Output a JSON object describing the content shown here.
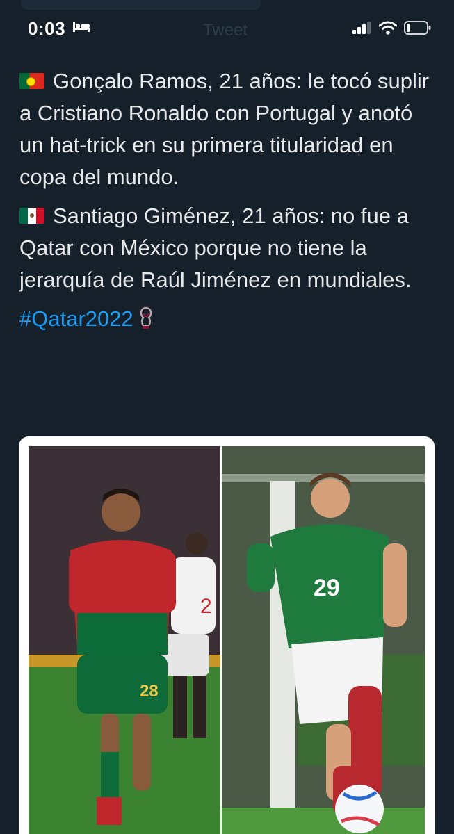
{
  "status_bar": {
    "time": "0:03",
    "background_title": "Tweet"
  },
  "tweet": {
    "paragraphs": [
      {
        "flag": "portugal-flag",
        "text": "Gonçalo Ramos, 21 años: le tocó suplir a Cristiano Ronaldo con Portugal y anotó un hat-trick en su primera titularidad en copa del mundo."
      },
      {
        "flag": "mexico-flag",
        "text": "Santiago Giménez, 21 años: no fue a Qatar con México porque no tiene la jerarquía de Raúl Jiménez en mundiales."
      }
    ],
    "hashtag": "#Qatar2022"
  },
  "media": {
    "left_player": {
      "shirt_number": "28"
    },
    "right_player": {
      "shirt_number": "29"
    }
  },
  "colors": {
    "background": "#15202b",
    "text": "#e7e9ea",
    "link": "#1d9bf0"
  }
}
